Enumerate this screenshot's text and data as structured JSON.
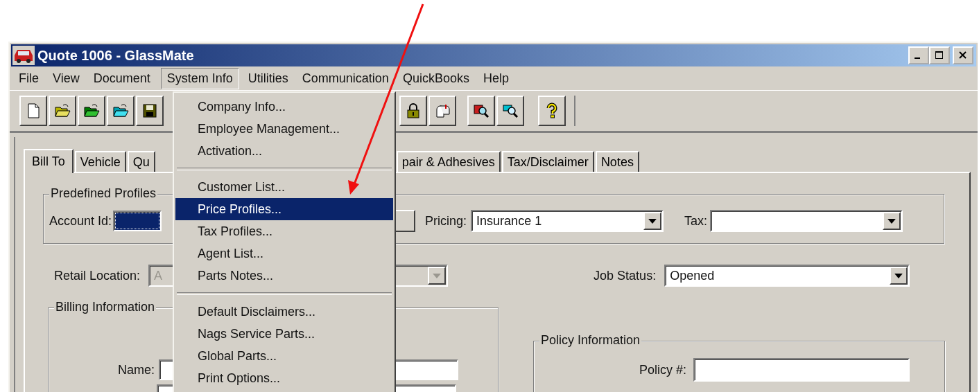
{
  "window": {
    "title": "Quote 1006 - GlassMate"
  },
  "menu_bar": [
    {
      "label": "File",
      "selected": false
    },
    {
      "label": "View",
      "selected": false
    },
    {
      "label": "Document",
      "selected": false
    },
    {
      "label": "System Info",
      "selected": true
    },
    {
      "label": "Utilities",
      "selected": false
    },
    {
      "label": "Communication",
      "selected": false
    },
    {
      "label": "QuickBooks",
      "selected": false
    },
    {
      "label": "Help",
      "selected": false
    }
  ],
  "tabs": [
    {
      "label": "Bill To",
      "selected": true
    },
    {
      "label": "Vehicle",
      "selected": false
    },
    {
      "label": "Qu",
      "selected": false
    },
    {
      "label": "pair & Adhesives",
      "selected": false
    },
    {
      "label": "Tax/Disclaimer",
      "selected": false
    },
    {
      "label": "Notes",
      "selected": false
    }
  ],
  "predefined_profiles": {
    "title": "Predefined Profiles",
    "account_id_label": "Account Id:",
    "pricing_label": "Pricing:",
    "pricing_value": "Insurance 1",
    "tax_label": "Tax:"
  },
  "retail_location": {
    "label": "Retail Location:",
    "value": "A",
    "disabled": true
  },
  "job_status": {
    "label": "Job Status:",
    "value": "Opened"
  },
  "billing": {
    "title": "Billing Information",
    "name_label": "Name:"
  },
  "policy": {
    "title": "Policy Information",
    "policy_label": "Policy #:"
  },
  "dropdown_menu": {
    "groups": [
      [
        {
          "label": "Company Info...",
          "selected": false
        },
        {
          "label": "Employee Management...",
          "selected": false
        },
        {
          "label": "Activation...",
          "selected": false
        }
      ],
      [
        {
          "label": "Customer List...",
          "selected": false
        },
        {
          "label": "Price Profiles...",
          "selected": true
        },
        {
          "label": "Tax Profiles...",
          "selected": false
        },
        {
          "label": "Agent List...",
          "selected": false
        },
        {
          "label": "Parts Notes...",
          "selected": false
        }
      ],
      [
        {
          "label": "Default Disclaimers...",
          "selected": false
        },
        {
          "label": "Nags Service Parts...",
          "selected": false
        },
        {
          "label": "Global Parts...",
          "selected": false
        },
        {
          "label": "Print Options...",
          "selected": false
        }
      ]
    ]
  }
}
